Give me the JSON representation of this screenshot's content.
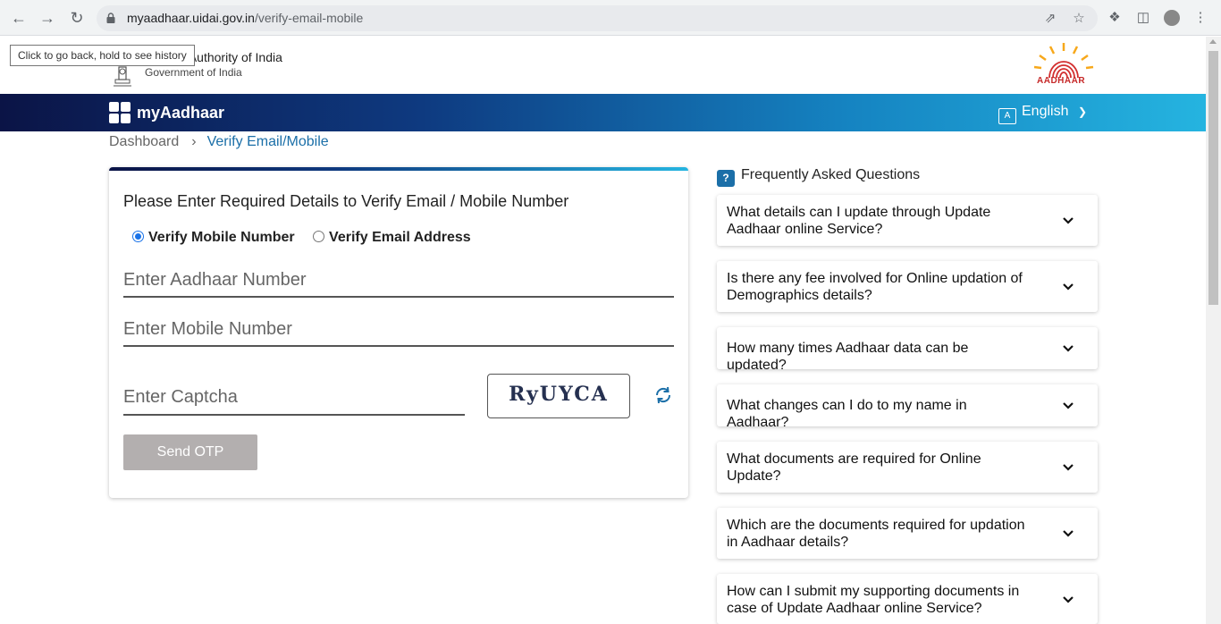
{
  "browser": {
    "url_host": "myaadhaar.uidai.gov.in",
    "url_path": "/verify-email-mobile",
    "tooltip": "Click to go back, hold to see history"
  },
  "header": {
    "org_name": "Unique Identification Authority of India",
    "org_visible": "dentification Authority of India",
    "gov_name": "Government of India",
    "logo_text": "AADHAAR"
  },
  "navbar": {
    "brand": "myAadhaar",
    "language": "English"
  },
  "breadcrumb": {
    "home": "Dashboard",
    "separator": "›",
    "current": "Verify Email/Mobile"
  },
  "form": {
    "title": "Please Enter Required Details to Verify Email / Mobile Number",
    "radio_mobile": "Verify Mobile Number",
    "radio_email": "Verify Email Address",
    "aadhaar_placeholder": "Enter Aadhaar Number",
    "mobile_placeholder": "Enter Mobile Number",
    "captcha_placeholder": "Enter Captcha",
    "captcha_text": "RyUYCA",
    "send_button": "Send OTP"
  },
  "faq": {
    "heading": "Frequently Asked Questions",
    "items": [
      {
        "q": "What details can I update through Update Aadhaar online Service?"
      },
      {
        "q": "Is there any fee involved for Online updation of Demographics details?"
      },
      {
        "q": "How many times Aadhaar data can be updated?"
      },
      {
        "q": "What changes can I do to my name in Aadhaar?"
      },
      {
        "q": "What documents are required for Online Update?"
      },
      {
        "q": "Which are the documents required for updation in Aadhaar details?"
      },
      {
        "q": "How can I submit my supporting documents in case of Update Aadhaar online Service?"
      }
    ]
  },
  "colors": {
    "nav_start": "#0b1446",
    "nav_end": "#25b4e0",
    "link": "#1b6fa8",
    "button_disabled": "#b3afaf",
    "radio_accent": "#1a73e8"
  }
}
